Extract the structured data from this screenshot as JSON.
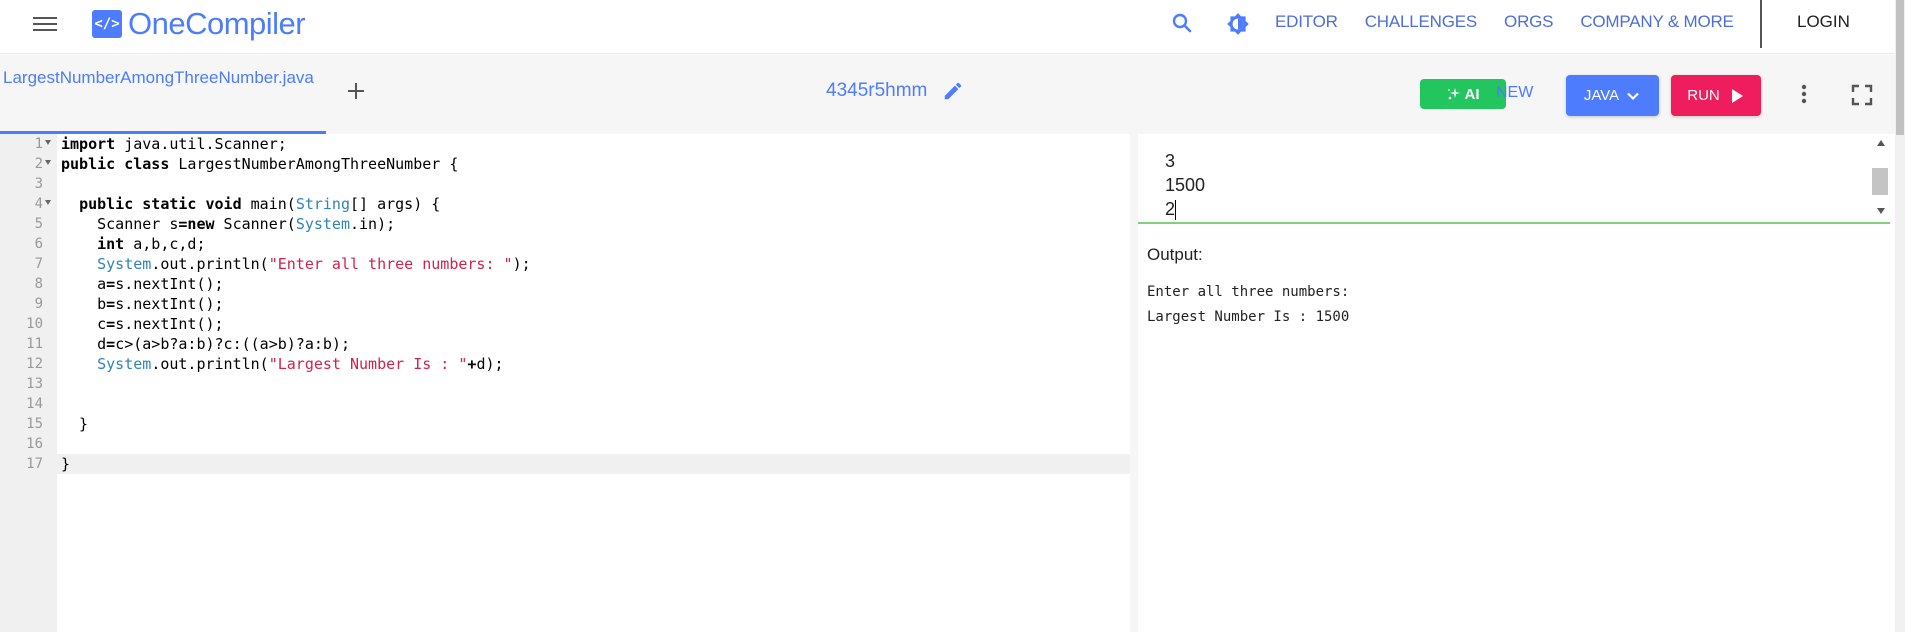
{
  "nav": {
    "brand": "OneCompiler",
    "brand_icon": "</>",
    "links": [
      "EDITOR",
      "CHALLENGES",
      "ORGS",
      "COMPANY & MORE"
    ],
    "login": "LOGIN"
  },
  "toolbar": {
    "file_tab": "LargestNumberAmongThreeNumber.java",
    "title": "4345r5hmm",
    "ai_label": "AI",
    "new_label": "NEW",
    "language": "JAVA",
    "run_label": "RUN"
  },
  "editor": {
    "line_numbers": [
      "1",
      "2",
      "3",
      "4",
      "5",
      "6",
      "7",
      "8",
      "9",
      "10",
      "11",
      "12",
      "13",
      "14",
      "15",
      "16",
      "17"
    ],
    "active_line": 17
  },
  "stdin": {
    "lines": [
      "3",
      "1500",
      "2"
    ]
  },
  "output": {
    "label": "Output:",
    "lines": [
      "Enter all three numbers: ",
      "Largest Number Is : 1500"
    ]
  },
  "colors": {
    "accent": "#4d7cfe",
    "run": "#ef1d5e",
    "ai": "#22c55e",
    "keyword": "#000000",
    "type": "#2f84b5",
    "string": "#d2214a"
  },
  "icons": {
    "menu": "hamburger-icon",
    "search": "search-icon",
    "theme": "brightness-icon",
    "add": "plus-icon",
    "edit": "pencil-icon",
    "ai": "sparkle-icon",
    "language": "chevron-down-icon",
    "run": "play-icon",
    "more": "more-vertical-icon",
    "fullscreen": "fullscreen-icon"
  }
}
